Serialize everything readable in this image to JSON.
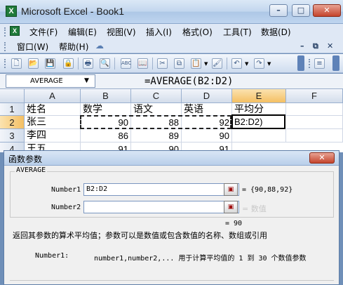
{
  "window": {
    "title": "Microsoft Excel - Book1",
    "app_icon": "X",
    "minimize": "–",
    "restore": "□",
    "close": "✕"
  },
  "menu": {
    "items": [
      "文件(F)",
      "编辑(E)",
      "视图(V)",
      "插入(I)",
      "格式(O)",
      "工具(T)",
      "数据(D)"
    ],
    "items_row2": [
      "窗口(W)",
      "帮助(H)"
    ],
    "doc_icon": "X",
    "mdi_minimize": "–",
    "mdi_restore": "⧉",
    "mdi_close": "✕"
  },
  "toolbar": {
    "icons": [
      "new-icon",
      "open-icon",
      "save-icon",
      "permission-icon",
      "print-icon",
      "print-preview-icon",
      "spelling-icon",
      "research-icon",
      "cut-icon",
      "copy-icon",
      "paste-icon",
      "format-painter-icon",
      "undo-icon",
      "redo-icon"
    ],
    "glyphs": [
      "🗋",
      "📂",
      "💾",
      "🔒",
      "🖶",
      "🔍",
      "ABC",
      "📖",
      "✂",
      "⧉",
      "📋",
      "🖌",
      "↶",
      "↷"
    ]
  },
  "formula_bar": {
    "name_box": "AVERAGE",
    "formula": "=AVERAGE(B2:D2)"
  },
  "sheet": {
    "columns": [
      "A",
      "B",
      "C",
      "D",
      "E",
      "F"
    ],
    "rows": [
      "1",
      "2",
      "3",
      "4"
    ],
    "cells": [
      [
        "姓名",
        "数学",
        "语文",
        "英语",
        "平均分",
        ""
      ],
      [
        "张三",
        "90",
        "88",
        "92",
        "",
        ""
      ],
      [
        "李四",
        "86",
        "89",
        "90",
        "",
        ""
      ],
      [
        "王五",
        "91",
        "90",
        "91",
        "",
        ""
      ]
    ],
    "active_cell_text": "B2:D2)"
  },
  "dialog": {
    "title": "函数参数",
    "close": "✕",
    "function_name": "AVERAGE",
    "args": [
      {
        "label": "Number1",
        "value": "B2:D2",
        "result": "= {90,88,92}"
      },
      {
        "label": "Number2",
        "value": "",
        "result": "= 数值"
      }
    ],
    "result": "= 90",
    "description": "返回其参数的算术平均值；参数可以是数值或包含数值的名称、数组或引用",
    "arg_desc_name": "Number1:",
    "arg_desc_text": "number1,number2,... 用于计算平均值的 1 到 30 个数值参数"
  }
}
